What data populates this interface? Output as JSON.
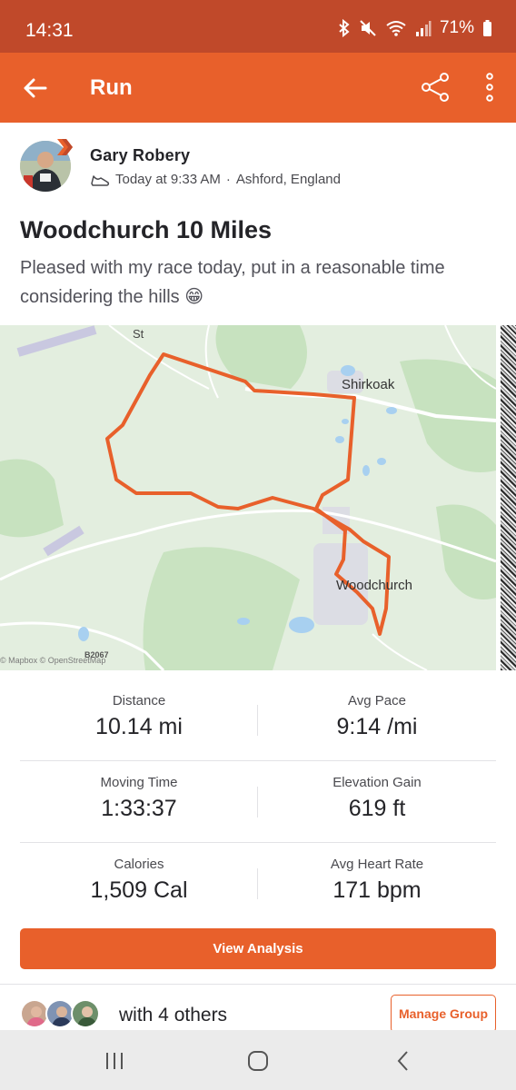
{
  "status_bar": {
    "time": "14:31",
    "battery": "71%",
    "icons": [
      "bluetooth-icon",
      "mute-icon",
      "wifi-icon",
      "signal-icon",
      "battery-icon"
    ]
  },
  "app_bar": {
    "title": "Run",
    "icons": [
      "back-arrow-icon",
      "share-icon",
      "more-vertical-icon"
    ]
  },
  "athlete": {
    "name": "Gary Robery",
    "time": "Today at 9:33 AM",
    "separator": "·",
    "location": "Ashford, England"
  },
  "activity": {
    "title": "Woodchurch 10 Miles",
    "description": "Pleased with my race today, put in a reasonable time considering the hills 😁"
  },
  "map": {
    "labels": {
      "village_1": "Shirkoak",
      "village_2": "Woodchurch",
      "road": "B2067",
      "street_fragment": "St",
      "attribution": "© Mapbox © OpenStreetMap"
    },
    "route_color": "#e8602b"
  },
  "stats": [
    {
      "label": "Distance",
      "value": "10.14 mi"
    },
    {
      "label": "Avg Pace",
      "value": "9:14 /mi"
    },
    {
      "label": "Moving Time",
      "value": "1:33:37"
    },
    {
      "label": "Elevation Gain",
      "value": "619 ft"
    },
    {
      "label": "Calories",
      "value": "1,509 Cal"
    },
    {
      "label": "Avg Heart Rate",
      "value": "171 bpm"
    }
  ],
  "actions": {
    "view_analysis": "View Analysis",
    "manage_group": "Manage Group",
    "group_text": "with 4 others"
  },
  "colors": {
    "brand": "#e8602b",
    "status_bar": "#c0492a"
  }
}
